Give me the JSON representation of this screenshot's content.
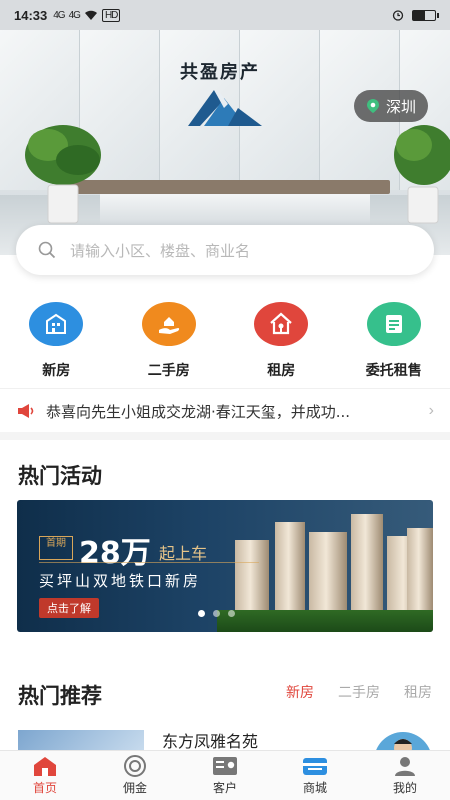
{
  "status_bar": {
    "time": "14:33",
    "signal_1": "4G",
    "signal_2": "4G",
    "hd": "HD"
  },
  "banner": {
    "company_name": "共盈房产",
    "city": "深圳"
  },
  "search": {
    "placeholder": "请输入小区、楼盘、商业名"
  },
  "categories": [
    {
      "label": "新房",
      "icon": "new-house-icon",
      "color": "#2d8fe0"
    },
    {
      "label": "二手房",
      "icon": "hand-house-icon",
      "color": "#f08a1e"
    },
    {
      "label": "租房",
      "icon": "rent-house-icon",
      "color": "#e0463c"
    },
    {
      "label": "委托租售",
      "icon": "commission-icon",
      "color": "#36c08c"
    }
  ],
  "notice": {
    "icon": "megaphone-icon",
    "text": "恭喜向先生小姐成交龙湖·春江天玺，并成功..."
  },
  "hot_activities": {
    "title": "热门活动",
    "promo": {
      "prefix": "首期",
      "amount": "28万",
      "suffix": "起上车",
      "subtitle": "买坪山双地铁口新房",
      "button": "点击了解"
    }
  },
  "recommend": {
    "title": "热门推荐",
    "tabs": [
      "新房",
      "二手房",
      "租房"
    ],
    "active_tab": "新房",
    "first_item": "东方凤雅名苑"
  },
  "bottom_nav": [
    {
      "label": "首页",
      "icon": "home-icon",
      "active": true
    },
    {
      "label": "佣金",
      "icon": "commission-coin-icon",
      "active": false
    },
    {
      "label": "客户",
      "icon": "customer-card-icon",
      "active": false
    },
    {
      "label": "商城",
      "icon": "mall-icon",
      "active": false
    },
    {
      "label": "我的",
      "icon": "profile-icon",
      "active": false
    }
  ],
  "colors": {
    "accent": "#e0463c",
    "nav_inactive": "#777777"
  }
}
